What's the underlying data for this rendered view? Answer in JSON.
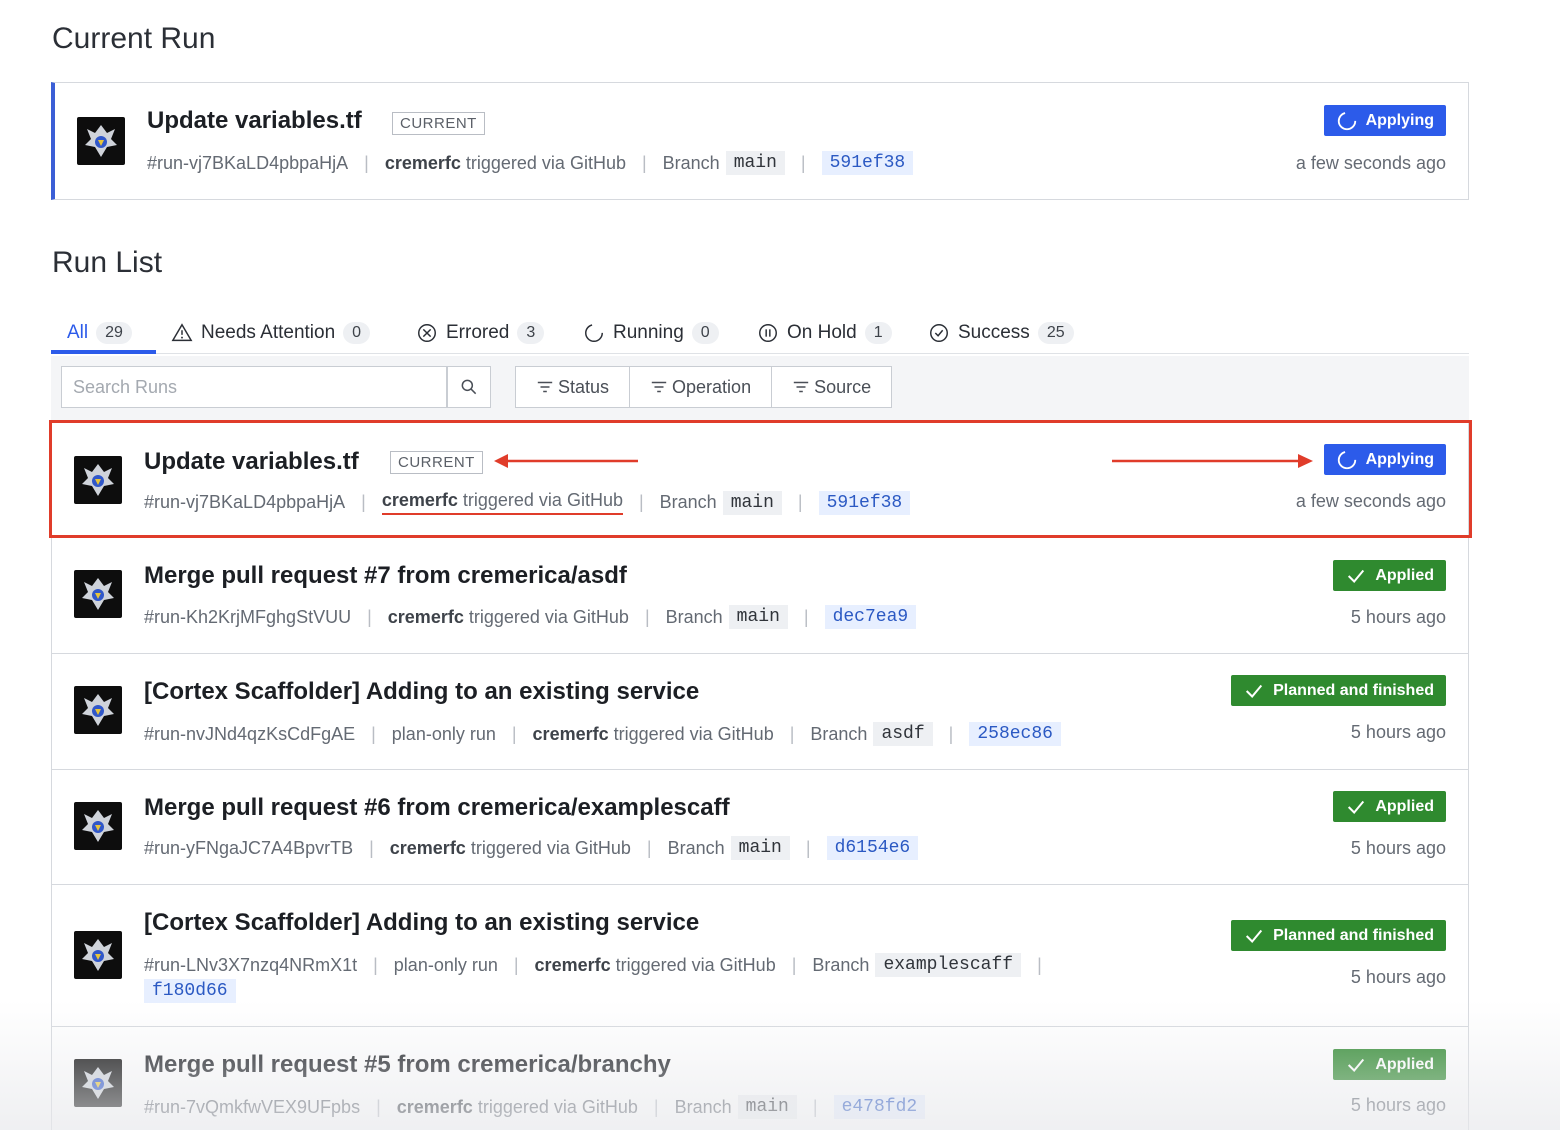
{
  "current_run": {
    "section_title": "Current Run",
    "title": "Update variables.tf",
    "tag": "CURRENT",
    "run_id": "#run-vj7BKaLD4pbpaHjA",
    "user": "cremerfc",
    "trigger_text": "triggered via GitHub",
    "branch_label": "Branch",
    "branch": "main",
    "sha": "591ef38",
    "status": "Applying",
    "time": "a few seconds ago"
  },
  "run_list": {
    "section_title": "Run List",
    "tabs": [
      {
        "label": "All",
        "count": "29",
        "icon": "none"
      },
      {
        "label": "Needs Attention",
        "count": "0",
        "icon": "warning-icon"
      },
      {
        "label": "Errored",
        "count": "3",
        "icon": "error-circle-icon"
      },
      {
        "label": "Running",
        "count": "0",
        "icon": "spinner-icon"
      },
      {
        "label": "On Hold",
        "count": "1",
        "icon": "pause-circle-icon"
      },
      {
        "label": "Success",
        "count": "25",
        "icon": "check-circle-icon"
      }
    ],
    "search_placeholder": "Search Runs",
    "filters": [
      "Status",
      "Operation",
      "Source"
    ],
    "runs": [
      {
        "title": "Update variables.tf",
        "tag": "CURRENT",
        "run_id": "#run-vj7BKaLD4pbpaHjA",
        "plan_only": "",
        "user": "cremerfc",
        "trigger_text": "triggered via GitHub",
        "branch": "main",
        "sha": "591ef38",
        "status": "Applying",
        "time": "a few seconds ago"
      },
      {
        "title": "Merge pull request #7 from cremerica/asdf",
        "run_id": "#run-Kh2KrjMFghgStVUU",
        "user": "cremerfc",
        "trigger_text": "triggered via GitHub",
        "branch": "main",
        "sha": "dec7ea9",
        "status": "Applied",
        "time": "5 hours ago"
      },
      {
        "title": "[Cortex Scaffolder] Adding to an existing service",
        "run_id": "#run-nvJNd4qzKsCdFgAE",
        "plan_only": "plan-only run",
        "user": "cremerfc",
        "trigger_text": "triggered via GitHub",
        "branch": "asdf",
        "sha": "258ec86",
        "status": "Planned and finished",
        "time": "5 hours ago"
      },
      {
        "title": "Merge pull request #6 from cremerica/examplescaff",
        "run_id": "#run-yFNgaJC7A4BpvrTB",
        "user": "cremerfc",
        "trigger_text": "triggered via GitHub",
        "branch": "main",
        "sha": "d6154e6",
        "status": "Applied",
        "time": "5 hours ago"
      },
      {
        "title": "[Cortex Scaffolder] Adding to an existing service",
        "run_id": "#run-LNv3X7nzq4NRmX1t",
        "plan_only": "plan-only run",
        "user": "cremerfc",
        "trigger_text": "triggered via GitHub",
        "branch": "examplescaff",
        "sha": "f180d66",
        "status": "Planned and finished",
        "time": "5 hours ago"
      },
      {
        "title": "Merge pull request #5 from cremerica/branchy",
        "run_id": "#run-7vQmkfwVEX9UFpbs",
        "user": "cremerfc",
        "trigger_text": "triggered via GitHub",
        "branch": "main",
        "sha": "e478fd2",
        "status": "Applied",
        "time": "5 hours ago"
      }
    ],
    "branch_label": "Branch"
  },
  "colors": {
    "accent": "#2c5bea",
    "success": "#2f8a2f",
    "highlight": "#e03c2a"
  }
}
